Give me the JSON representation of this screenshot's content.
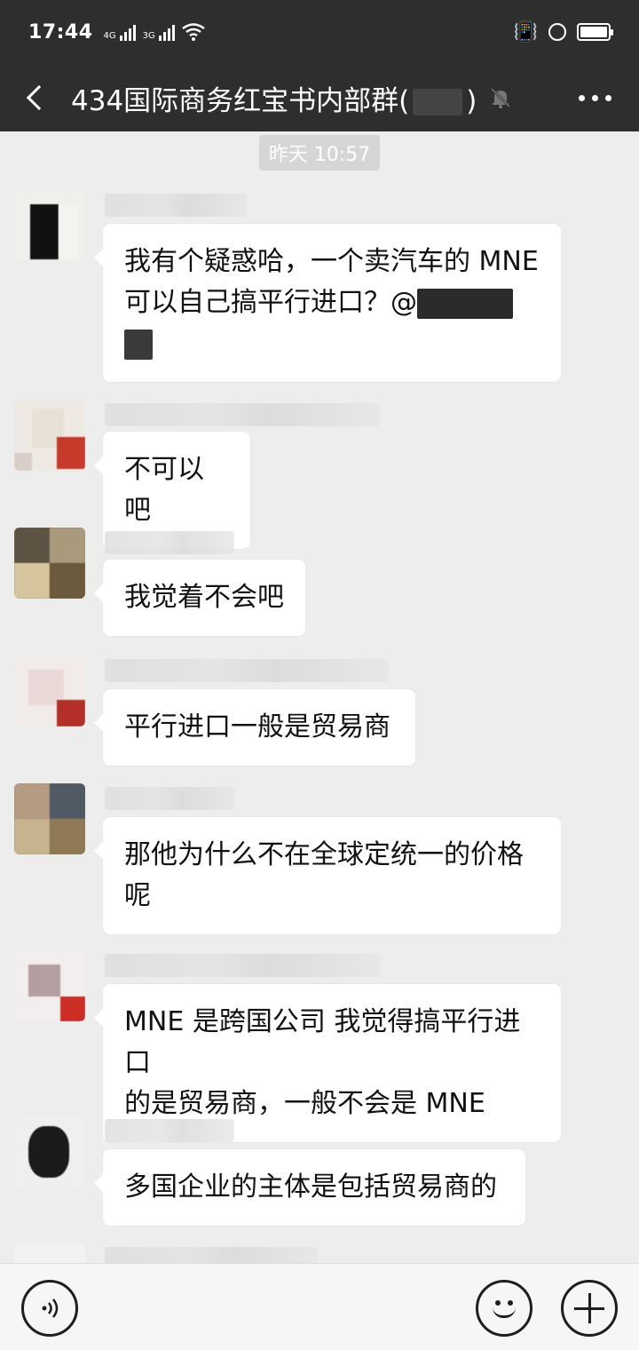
{
  "status_bar": {
    "time": "17:44",
    "net1": "4G",
    "net2": "3G"
  },
  "header": {
    "title": "434国际商务红宝书内部群(",
    "title_suffix": ")"
  },
  "chat": {
    "timestamp": "昨天 10:57",
    "messages": [
      {
        "text_line1": "我有个疑惑哈，一个卖汽车的 MNE",
        "text_line2": "可以自己搞平行进口？@"
      },
      {
        "text": "不可以吧"
      },
      {
        "text": "我觉着不会吧"
      },
      {
        "text": "平行进口一般是贸易商"
      },
      {
        "text_line1": "那他为什么不在全球定统一的价格",
        "text_line2": "呢"
      },
      {
        "text_line1": "MNE 是跨国公司 我觉得搞平行进口",
        "text_line2": "的是贸易商，一般不会是 MNE"
      },
      {
        "text": "多国企业的主体是包括贸易商的"
      }
    ]
  },
  "icons": {
    "back": "back-arrow-icon",
    "mute": "mute-bell-icon",
    "more": "more-dots-icon",
    "voice": "voice-icon",
    "emoji": "emoji-icon",
    "plus": "plus-icon"
  },
  "colors": {
    "header_bg": "#2e2e2e",
    "chat_bg": "#ededed",
    "bubble_bg": "#ffffff"
  }
}
